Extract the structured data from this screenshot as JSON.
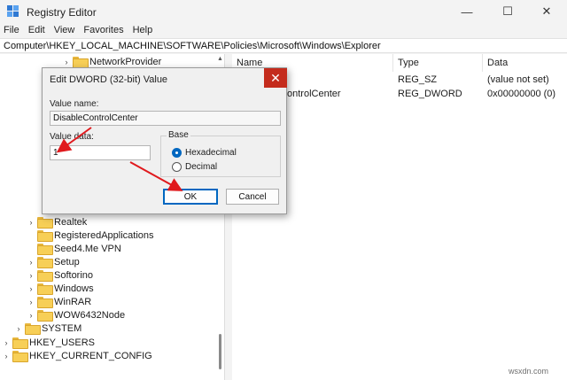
{
  "window": {
    "title": "Registry Editor",
    "minimize_glyph": "—",
    "maximize_glyph": "☐",
    "close_glyph": "✕"
  },
  "menu": [
    "File",
    "Edit",
    "View",
    "Favorites",
    "Help"
  ],
  "address": "Computer\\HKEY_LOCAL_MACHINE\\SOFTWARE\\Policies\\Microsoft\\Windows\\Explorer",
  "tree": {
    "items": [
      {
        "label": "NetworkProvider",
        "expander": "›"
      },
      {
        "label": "Realtek",
        "expander": "›"
      },
      {
        "label": "RegisteredApplications",
        "expander": ""
      },
      {
        "label": "Seed4.Me VPN",
        "expander": ""
      },
      {
        "label": "Setup",
        "expander": "›"
      },
      {
        "label": "Softorino",
        "expander": "›"
      },
      {
        "label": "Windows",
        "expander": "›"
      },
      {
        "label": "WinRAR",
        "expander": "›"
      },
      {
        "label": "WOW6432Node",
        "expander": "›"
      },
      {
        "label": "SYSTEM",
        "expander": "›"
      },
      {
        "label": "HKEY_USERS",
        "expander": "›"
      },
      {
        "label": "HKEY_CURRENT_CONFIG",
        "expander": "›"
      }
    ],
    "scroll_up_glyph": "▲"
  },
  "list": {
    "columns": [
      "Name",
      "Type",
      "Data"
    ],
    "rows": [
      {
        "name": "",
        "type": "REG_SZ",
        "data": "(value not set)"
      },
      {
        "name": "ontrolCenter",
        "type": "REG_DWORD",
        "data": "0x00000000 (0)"
      }
    ]
  },
  "dialog": {
    "title": "Edit DWORD (32-bit) Value",
    "close_glyph": "✕",
    "value_name_label": "Value name:",
    "value_name": "DisableControlCenter",
    "value_data_label": "Value data:",
    "value_data": "1",
    "base_label": "Base",
    "base_options": [
      "Hexadecimal",
      "Decimal"
    ],
    "base_selected": "Hexadecimal",
    "ok_label": "OK",
    "cancel_label": "Cancel"
  },
  "annotations": {
    "arrow_color": "#e0191d"
  },
  "watermark": "wsxdn.com"
}
